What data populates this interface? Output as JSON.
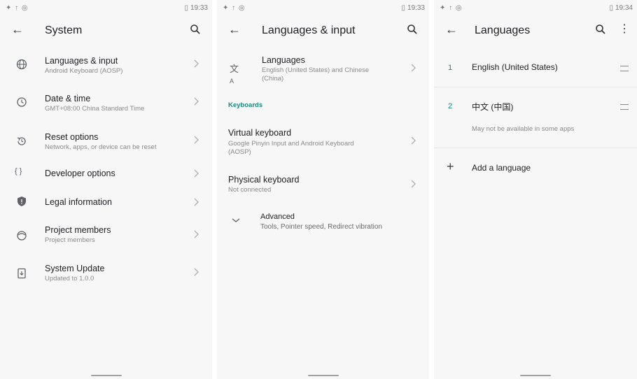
{
  "status": {
    "icons_left": "✦ ↑ ◎",
    "time_1": "19:33",
    "time_2": "19:33",
    "time_3": "19:34"
  },
  "system": {
    "title": "System",
    "items": [
      {
        "title": "Languages & input",
        "subtitle": "Android Keyboard (AOSP)",
        "icon": "globe-icon"
      },
      {
        "title": "Date & time",
        "subtitle": "GMT+08:00 China Standard Time",
        "icon": "clock-icon"
      },
      {
        "title": "Reset options",
        "subtitle": "Network, apps, or device can be reset",
        "icon": "history-icon"
      },
      {
        "title": "Developer options",
        "subtitle": "",
        "icon": "braces-icon"
      },
      {
        "title": "Legal information",
        "subtitle": "",
        "icon": "shield-icon"
      },
      {
        "title": "Project members",
        "subtitle": "Project members",
        "icon": "smiley-icon"
      },
      {
        "title": "System Update",
        "subtitle": "Updated to  1.0.0",
        "icon": "update-icon"
      }
    ]
  },
  "lang_input": {
    "title": "Languages & input",
    "languages": {
      "title": "Languages",
      "subtitle_1": "English (United States) and Chinese",
      "subtitle_2": "(China)"
    },
    "keyboards_header": "Keyboards",
    "virtual": {
      "title": "Virtual keyboard",
      "subtitle_1": "Google Pinyin Input and Android Keyboard",
      "subtitle_2": "(AOSP)"
    },
    "physical": {
      "title": "Physical keyboard",
      "subtitle": "Not connected"
    },
    "advanced": {
      "title": "Advanced",
      "subtitle": "Tools, Pointer speed, Redirect vibration"
    }
  },
  "languages": {
    "title": "Languages",
    "list": [
      {
        "num": "1",
        "name": "English (United States)",
        "note": ""
      },
      {
        "num": "2",
        "name": "中文 (中国)",
        "note": "May not be available in some apps"
      }
    ],
    "add": "Add a language"
  }
}
